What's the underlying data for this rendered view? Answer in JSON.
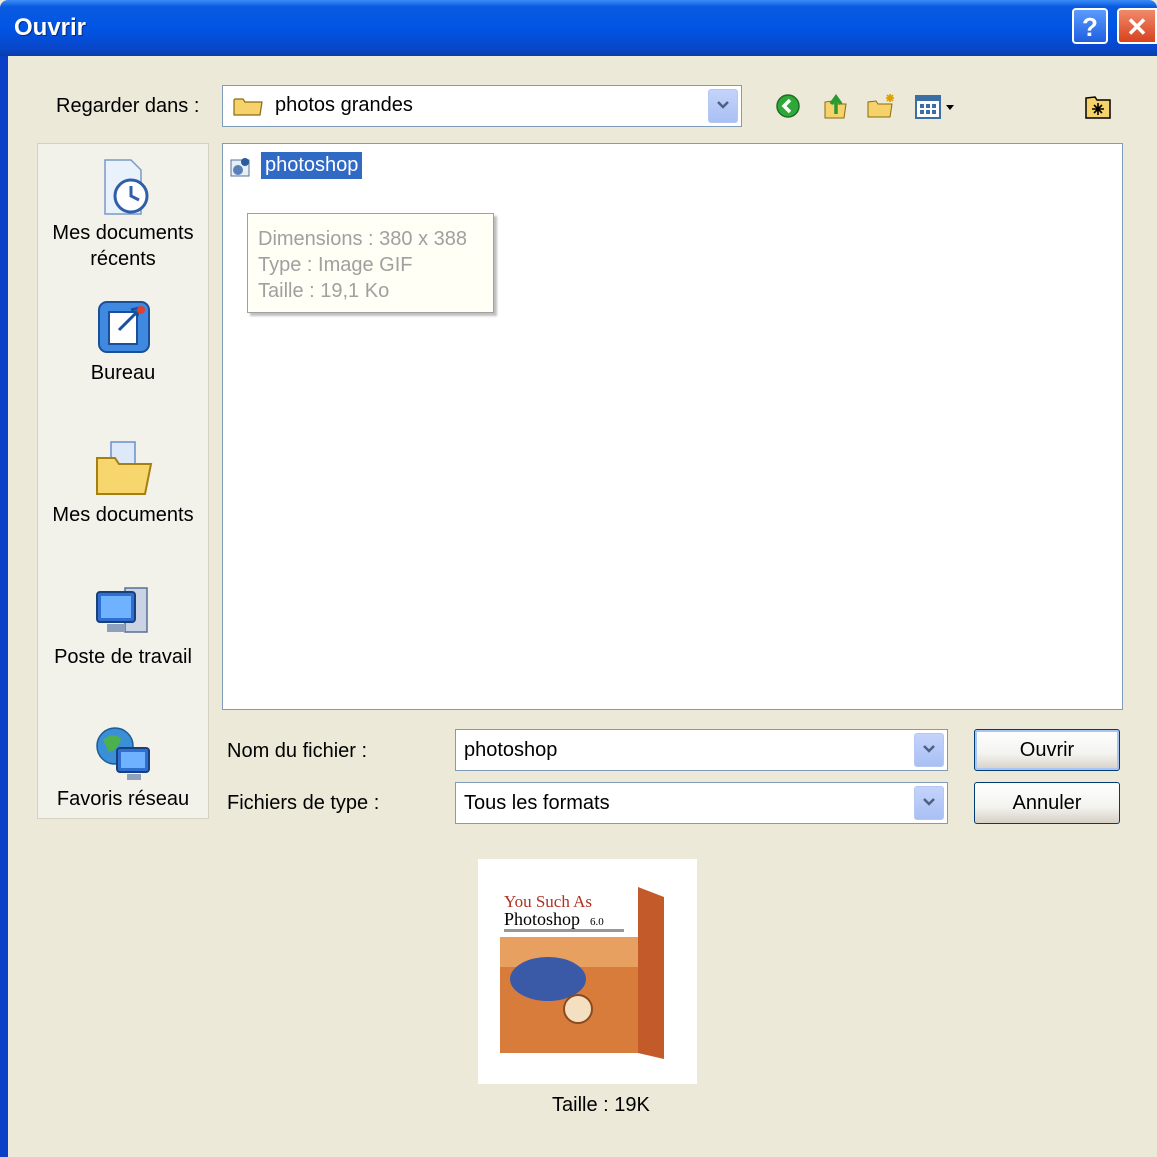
{
  "window": {
    "title": "Ouvrir",
    "help": "?",
    "close": "✕"
  },
  "toolbar": {
    "lookin_label": "Regarder dans :",
    "lookin_value": "photos grandes",
    "icons": [
      "back-icon",
      "up-folder-icon",
      "new-folder-icon",
      "views-menu-icon",
      "desktop-icon"
    ]
  },
  "places": [
    {
      "label": "Mes documents récents",
      "icon": "recent-documents-icon"
    },
    {
      "label": "Bureau",
      "icon": "desktop-icon"
    },
    {
      "label": "Mes documents",
      "icon": "my-documents-icon"
    },
    {
      "label": "Poste de travail",
      "icon": "my-computer-icon"
    },
    {
      "label": "Favoris réseau",
      "icon": "network-places-icon"
    }
  ],
  "file_list": {
    "items": [
      {
        "name": "photoshop",
        "selected": true,
        "icon": "gif-image-icon"
      }
    ],
    "tooltip": {
      "dimensions": "Dimensions : 380 x 388",
      "type": "Type : Image GIF",
      "size": "Taille  : 19,1 Ko"
    }
  },
  "form": {
    "filename_label": "Nom du fichier :",
    "filename_value": "photoshop",
    "filetype_label": "Fichiers de type :",
    "filetype_value": "Tous les formats"
  },
  "buttons": {
    "open": "Ouvrir",
    "cancel": "Annuler"
  },
  "preview": {
    "size_label": "Taille : 19K",
    "box_text_line1": "You Such As",
    "box_text_line2": "Photoshop",
    "box_text_version": "6.0"
  },
  "colors": {
    "title_bar": "#0055e5",
    "selection": "#316ac5",
    "dialog_bg": "#ece9d8"
  }
}
